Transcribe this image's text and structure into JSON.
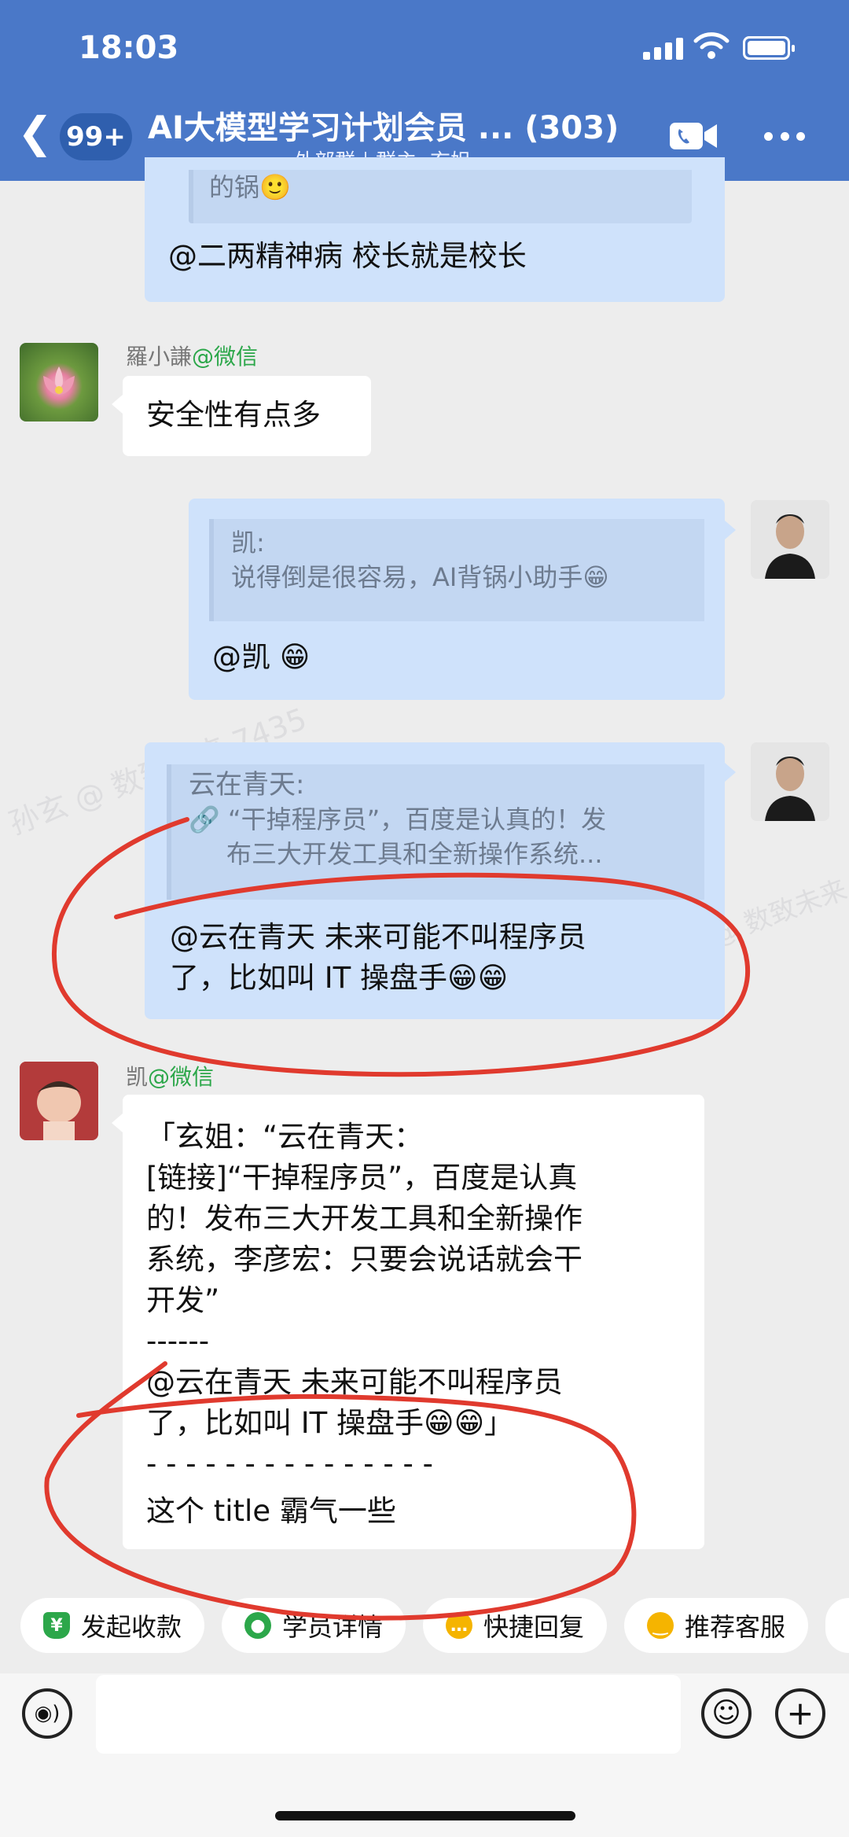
{
  "status_bar": {
    "time": "18:03"
  },
  "header": {
    "unread_count": "99+",
    "title": "AI大模型学习计划会员 ... (303)",
    "group_type": "外部群",
    "owner": "群主: 玄姐"
  },
  "messages": {
    "m1": {
      "quote_tail": "的锅🙂",
      "text": "@二两精神病 校长就是校长"
    },
    "m2": {
      "sender": "羅小謙",
      "source": "@微信",
      "text": "安全性有点多"
    },
    "m3": {
      "quote_author": "凯:",
      "quote_text": "说得倒是很容易，AI背锅小助手😁",
      "text": "@凯 😁"
    },
    "m4": {
      "quote_author": "云在青天:",
      "quote_line1": "“干掉程序员”，百度是认真的！发",
      "quote_line2": "布三大开发工具和全新操作系统...",
      "text_line1": "@云在青天 未来可能不叫程序员",
      "text_line2": "了，比如叫 IT 操盘手😁😁"
    },
    "m5": {
      "sender": "凯",
      "source": "@微信",
      "lines": [
        "「玄姐：“云在青天：",
        "[链接]“干掉程序员”，百度是认真",
        "的！发布三大开发工具和全新操作",
        "系统，李彦宏：只要会说话就会干",
        "开发”",
        "------",
        "@云在青天 未来可能不叫程序员",
        "了，比如叫 IT 操盘手😁😁」",
        "- - - - - - - - - - - - - - -",
        "这个 title 霸气一些"
      ]
    }
  },
  "watermark": "孙玄 @ 数致未来 7435",
  "quick_actions": [
    {
      "label": "发起收款",
      "icon": "shield-yen-icon",
      "color": "#2ca74a"
    },
    {
      "label": "学员详情",
      "icon": "person-icon",
      "color": "#2ca74a"
    },
    {
      "label": "快捷回复",
      "icon": "chat-bubble-icon",
      "color": "#f5b400"
    },
    {
      "label": "推荐客服",
      "icon": "smile-bubble-icon",
      "color": "#f5b400"
    }
  ],
  "colors": {
    "header": "#4a78c8",
    "bubble_self": "#cfe2fb",
    "annotation": "#e03a2e"
  }
}
